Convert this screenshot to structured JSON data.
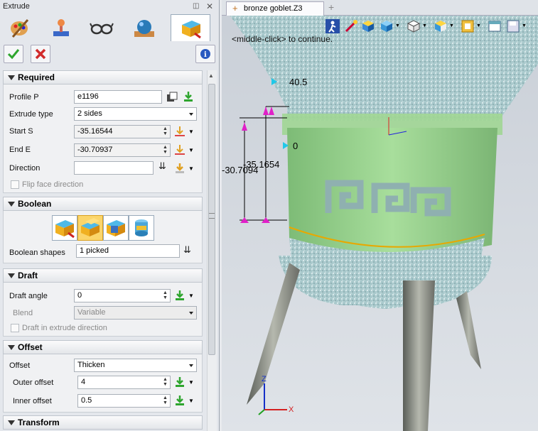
{
  "panel": {
    "title": "Extrude",
    "sections": {
      "required": "Required",
      "boolean": "Boolean",
      "draft": "Draft",
      "offset": "Offset",
      "transform": "Transform"
    },
    "required": {
      "profile_label": "Profile P",
      "profile_value": "e1196",
      "extrude_type_label": "Extrude type",
      "extrude_type_value": "2 sides",
      "start_label": "Start S",
      "start_value": "-35.16544",
      "end_label": "End E",
      "end_value": "-30.70937",
      "direction_label": "Direction",
      "direction_value": "",
      "flip_label": "Flip face direction"
    },
    "boolean": {
      "shapes_label": "Boolean shapes",
      "shapes_value": "1 picked"
    },
    "draft": {
      "angle_label": "Draft angle",
      "angle_value": "0",
      "blend_label": "Blend",
      "blend_value": "Variable",
      "extrude_dir_label": "Draft in extrude direction"
    },
    "offset": {
      "offset_label": "Offset",
      "offset_value": "Thicken",
      "outer_label": "Outer offset",
      "outer_value": "4",
      "inner_label": "Inner offset",
      "inner_value": "0.5"
    }
  },
  "viewport": {
    "tab_title": "bronze goblet.Z3",
    "hint": "<middle-click> to continue.",
    "dims": {
      "d1": "40.5",
      "d2": "0",
      "d3": "-35.1654",
      "d4": "-30.7094"
    },
    "axes": {
      "x": "X",
      "z": "Z"
    }
  },
  "colors": {
    "accent_green": "#8fcf86",
    "ok_green": "#2ea52e",
    "cancel_red": "#d12b2b",
    "handle_magenta": "#e020c8",
    "handle_cyan": "#21c8e8"
  }
}
